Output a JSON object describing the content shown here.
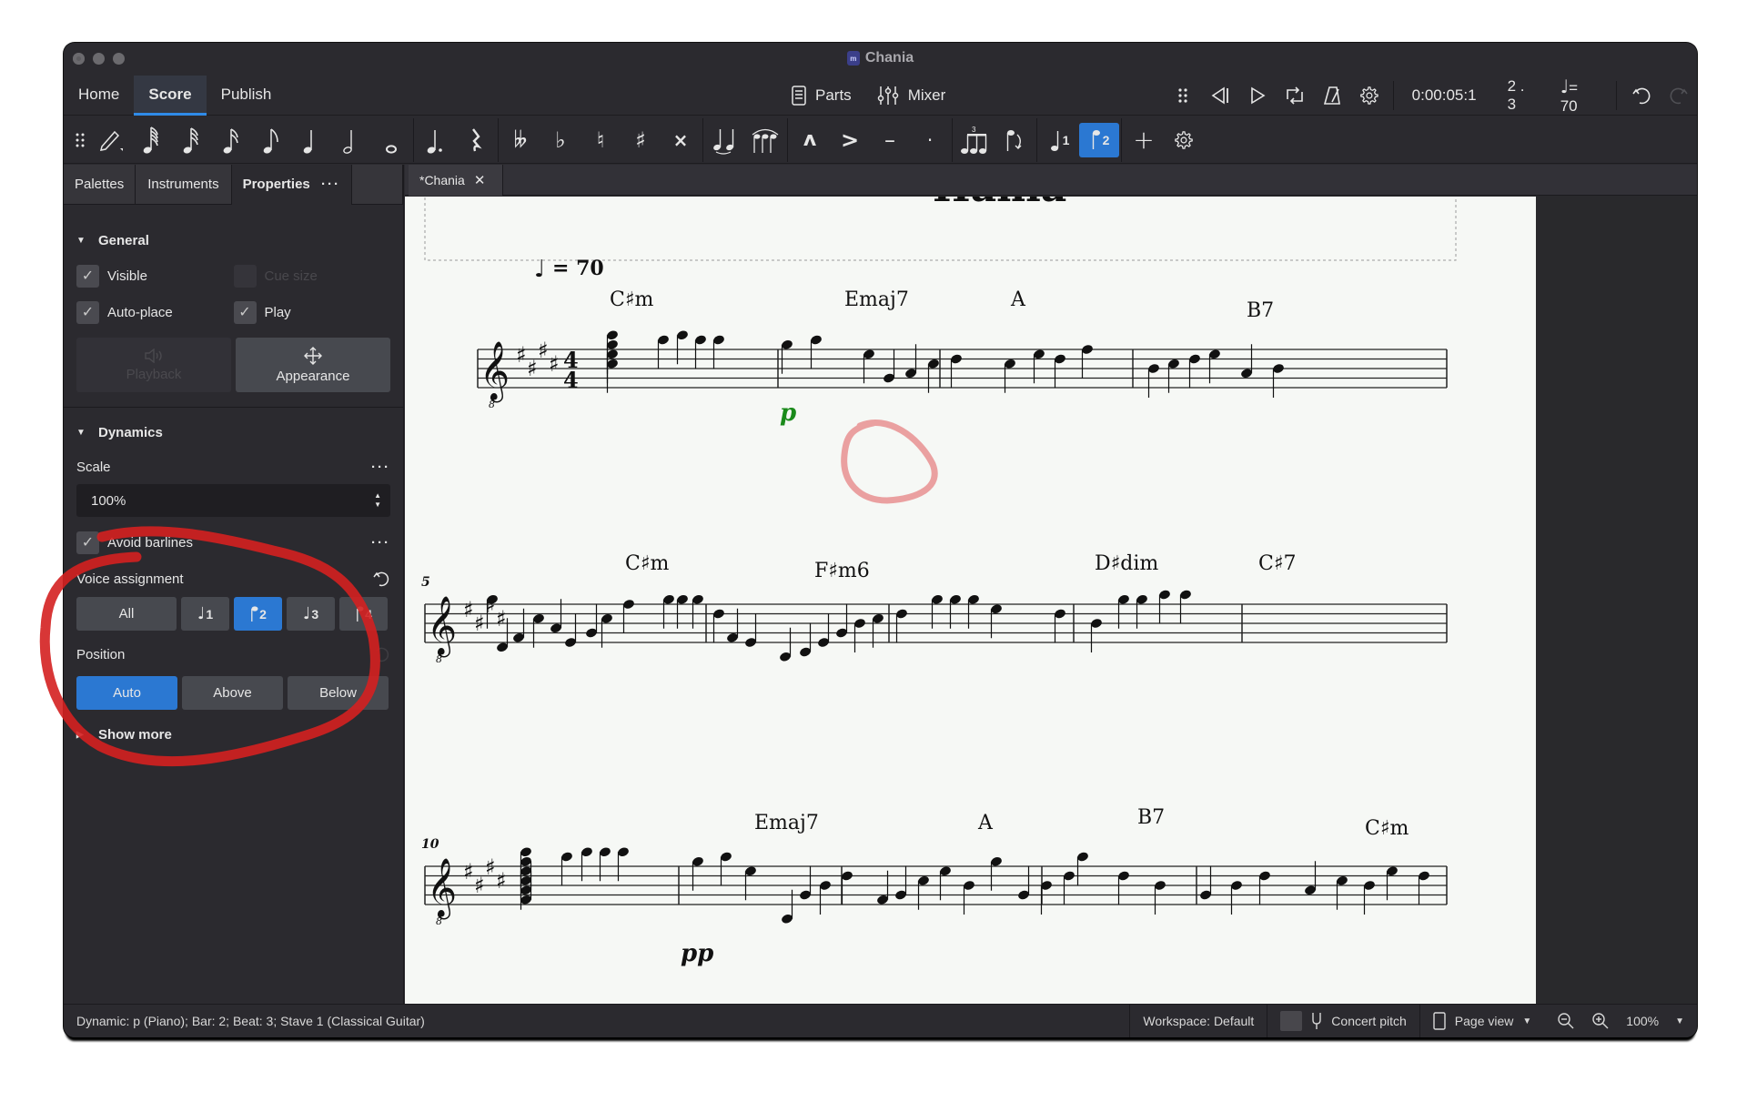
{
  "window": {
    "title": "Chania",
    "app_icon": "musescore-file-icon"
  },
  "menu": {
    "tabs": [
      {
        "label": "Home",
        "active": false
      },
      {
        "label": "Score",
        "active": true
      },
      {
        "label": "Publish",
        "active": false
      }
    ],
    "parts_label": "Parts",
    "mixer_label": "Mixer",
    "playback_time": "0:00:05:1",
    "position": "2 . 3",
    "tempo_value": "= 70",
    "accent_color": "#2b78d2"
  },
  "note_toolbar": {
    "groups": [
      [
        {
          "name": "note-input-pencil",
          "glyph": "✎"
        },
        {
          "name": "duration-64th",
          "glyph": "𝅘𝅥𝅲"
        },
        {
          "name": "duration-32nd",
          "glyph": "𝅘𝅥𝅱"
        },
        {
          "name": "duration-16th",
          "glyph": "𝅘𝅥𝅰"
        },
        {
          "name": "duration-eighth",
          "glyph": "♪"
        },
        {
          "name": "duration-quarter",
          "glyph": "♩"
        },
        {
          "name": "duration-half",
          "glyph": "𝅗𝅥"
        },
        {
          "name": "duration-whole",
          "glyph": "o"
        }
      ],
      [
        {
          "name": "augmentation-dot",
          "glyph": "♩."
        },
        {
          "name": "rest",
          "glyph": "𝄽"
        }
      ],
      [
        {
          "name": "double-flat",
          "glyph": "𝄫"
        },
        {
          "name": "flat",
          "glyph": "♭"
        },
        {
          "name": "natural",
          "glyph": "♮"
        },
        {
          "name": "sharp",
          "glyph": "♯"
        },
        {
          "name": "double-sharp",
          "glyph": "×"
        }
      ],
      [
        {
          "name": "tie",
          "glyph": "♩♩"
        },
        {
          "name": "slur",
          "glyph": "♪♪♪"
        }
      ],
      [
        {
          "name": "marcato",
          "glyph": "^"
        },
        {
          "name": "accent",
          "glyph": ">"
        },
        {
          "name": "tenuto",
          "glyph": "–"
        },
        {
          "name": "staccato",
          "glyph": "·"
        }
      ],
      [
        {
          "name": "tuplet",
          "glyph": "♬³"
        },
        {
          "name": "flip-direction",
          "glyph": "↺"
        }
      ],
      [
        {
          "name": "voice-1",
          "glyph": "♩",
          "num": "1",
          "active": false
        },
        {
          "name": "voice-2",
          "glyph": "♪",
          "num": "2",
          "active": true
        }
      ],
      [
        {
          "name": "add",
          "glyph": "+"
        },
        {
          "name": "customize-toolbar",
          "glyph": "⚙"
        }
      ]
    ]
  },
  "panel": {
    "tabs": [
      {
        "label": "Palettes",
        "active": false
      },
      {
        "label": "Instruments",
        "active": false
      },
      {
        "label": "Properties",
        "active": true
      }
    ],
    "tab_menu": "···",
    "general": {
      "title": "General",
      "visible": {
        "label": "Visible",
        "checked": true,
        "enabled": true
      },
      "cue_size": {
        "label": "Cue size",
        "checked": false,
        "enabled": false
      },
      "auto_place": {
        "label": "Auto-place",
        "checked": true,
        "enabled": true
      },
      "play": {
        "label": "Play",
        "checked": true,
        "enabled": true
      },
      "playback_btn": "Playback",
      "appearance_btn": "Appearance"
    },
    "dynamics": {
      "title": "Dynamics",
      "scale_label": "Scale",
      "scale_value": "100%",
      "avoid_barlines": {
        "label": "Avoid barlines",
        "checked": true
      },
      "voice_assignment_label": "Voice assignment",
      "voice_options": [
        {
          "label": "All",
          "active": false
        },
        {
          "label": "1",
          "active": false
        },
        {
          "label": "2",
          "active": true
        },
        {
          "label": "3",
          "active": false
        },
        {
          "label": "4",
          "active": false
        }
      ],
      "position_label": "Position",
      "position_options": [
        {
          "label": "Auto",
          "active": true
        },
        {
          "label": "Above",
          "active": false
        },
        {
          "label": "Below",
          "active": false
        }
      ],
      "show_more": "Show more"
    }
  },
  "document": {
    "tab_label": "*Chania",
    "title_partial": "Hania",
    "tempo_marking": "= 70",
    "measure_numbers": [
      "5",
      "10"
    ],
    "chord_symbols": {
      "system1": [
        "C♯m",
        "Emaj7",
        "A",
        "B7"
      ],
      "system2": [
        "C♯m",
        "F♯m6",
        "D♯dim",
        "C♯7"
      ],
      "system3": [
        "Emaj7",
        "A",
        "B7",
        "C♯m"
      ]
    },
    "dynamics": [
      {
        "text": "p",
        "selected": true,
        "color": "#1a8a1a"
      },
      {
        "text": "pp",
        "selected": false
      }
    ],
    "time_signature": "4/4",
    "key_signature_sharps": 4,
    "clef": "treble-8vb"
  },
  "status_bar": {
    "selection_info": "Dynamic: p (Piano); Bar: 2; Beat: 3; Stave 1 (Classical Guitar)",
    "workspace": "Workspace: Default",
    "concert_pitch": "Concert pitch",
    "view_mode": "Page view",
    "zoom": "100%"
  },
  "annotations": {
    "red_circle_around": "voice-assignment-and-position",
    "pink_circle_around": "selected-dynamic-p",
    "red_color": "#d42020",
    "pink_color": "#e89090"
  }
}
